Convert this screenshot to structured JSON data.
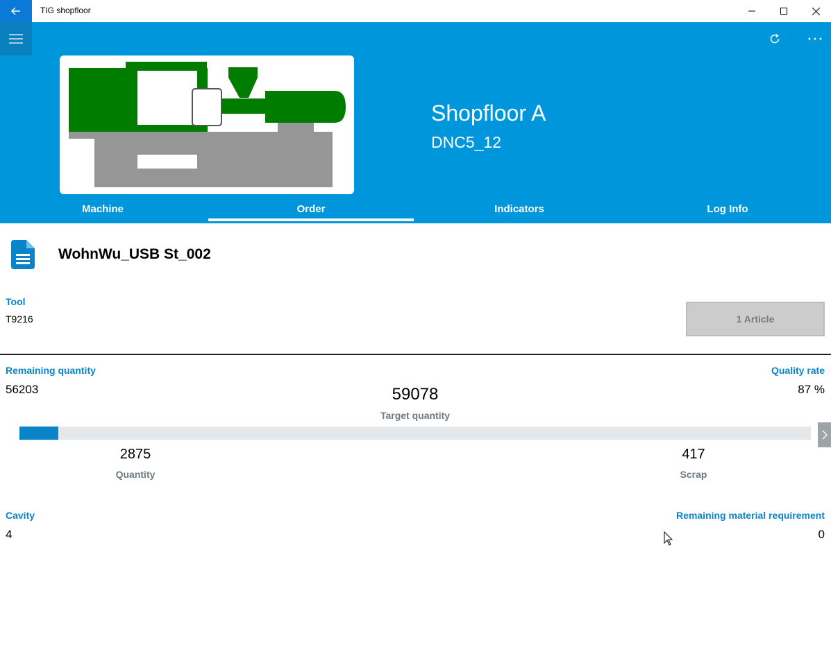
{
  "app": {
    "title": "TIG shopfloor"
  },
  "header": {
    "shopfloor": "Shopfloor A",
    "machine_id": "DNC5_12",
    "tabs": [
      {
        "label": "Machine"
      },
      {
        "label": "Order"
      },
      {
        "label": "Indicators"
      },
      {
        "label": "Log Info"
      }
    ],
    "active_tab": "Order"
  },
  "order": {
    "name": "WohnWu_USB St_002",
    "tool_label": "Tool",
    "tool_value": "T9216",
    "article_button": "1 Article",
    "remaining_quantity_label": "Remaining quantity",
    "remaining_quantity": "56203",
    "target_quantity": "59078",
    "target_quantity_label": "Target quantity",
    "quality_rate_label": "Quality rate",
    "quality_rate": "87 %",
    "progress_fraction": 0.0487,
    "quantity": "2875",
    "quantity_label": "Quantity",
    "scrap": "417",
    "scrap_label": "Scrap",
    "cavity_label": "Cavity",
    "cavity": "4",
    "material_label": "Remaining material requirement",
    "material": "0"
  },
  "colors": {
    "header_blue": "#0096dc",
    "accent_blue": "#0a84c8",
    "machine_green": "#007d00",
    "machine_gray": "#969696"
  },
  "icons": [
    "back-arrow-icon",
    "hamburger-icon",
    "refresh-icon",
    "more-icon",
    "document-icon",
    "chevron-right-icon"
  ]
}
